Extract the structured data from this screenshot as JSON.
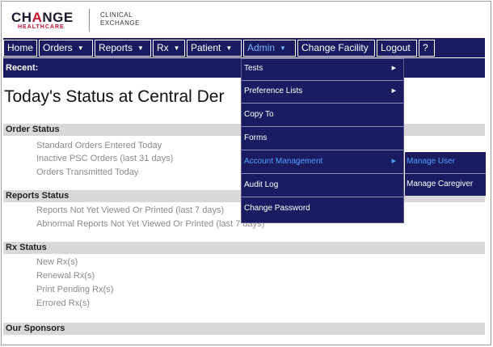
{
  "brand": {
    "name_part1": "CH",
    "name_accent": "A",
    "name_part2": "NGE",
    "subbrand": "HEALTHCARE",
    "product_line1": "CLINICAL",
    "product_line2": "EXCHANGE"
  },
  "nav": {
    "items": [
      {
        "label": "Home",
        "caret": ""
      },
      {
        "label": "Orders",
        "caret": "▼"
      },
      {
        "label": "Reports",
        "caret": "▼"
      },
      {
        "label": "Rx",
        "caret": "▼"
      },
      {
        "label": "Patient",
        "caret": "▼"
      },
      {
        "label": "Admin",
        "caret": "▼"
      },
      {
        "label": "Change Facility",
        "caret": ""
      },
      {
        "label": "Logout",
        "caret": ""
      },
      {
        "label": "?",
        "caret": ""
      }
    ]
  },
  "recent": {
    "label": "Recent:"
  },
  "page": {
    "title": "Today's Status at Central Der"
  },
  "sections": {
    "order_status": {
      "title": "Order Status",
      "items": [
        "Standard Orders Entered Today",
        "Inactive PSC Orders (last 31 days)",
        "Orders Transmitted Today"
      ]
    },
    "reports_status": {
      "title": "Reports Status",
      "items": [
        "Reports Not Yet Viewed Or Printed (last 7 days)",
        "Abnormal Reports Not Yet Viewed Or Printed (last 7 days)"
      ]
    },
    "rx_status": {
      "title": "Rx Status",
      "items": [
        "New Rx(s)",
        "Renewal Rx(s)",
        "Print Pending Rx(s)",
        "Errored Rx(s)"
      ]
    },
    "sponsors": {
      "title": "Our Sponsors"
    }
  },
  "admin_menu": {
    "items": [
      {
        "label": "Tests",
        "arrow": "▶"
      },
      {
        "label": "Preference Lists",
        "arrow": "▶"
      },
      {
        "label": "Copy To",
        "arrow": ""
      },
      {
        "label": "Forms",
        "arrow": ""
      },
      {
        "label": "Account Management",
        "arrow": "▶"
      },
      {
        "label": "Audit Log",
        "arrow": ""
      },
      {
        "label": "Change Password",
        "arrow": ""
      }
    ]
  },
  "account_submenu": {
    "items": [
      "Manage User",
      "Manage Caregiver"
    ]
  },
  "colors": {
    "nav_bg": "#1b1b62",
    "highlight": "#4ea3ff",
    "brand_red": "#c8102e"
  }
}
